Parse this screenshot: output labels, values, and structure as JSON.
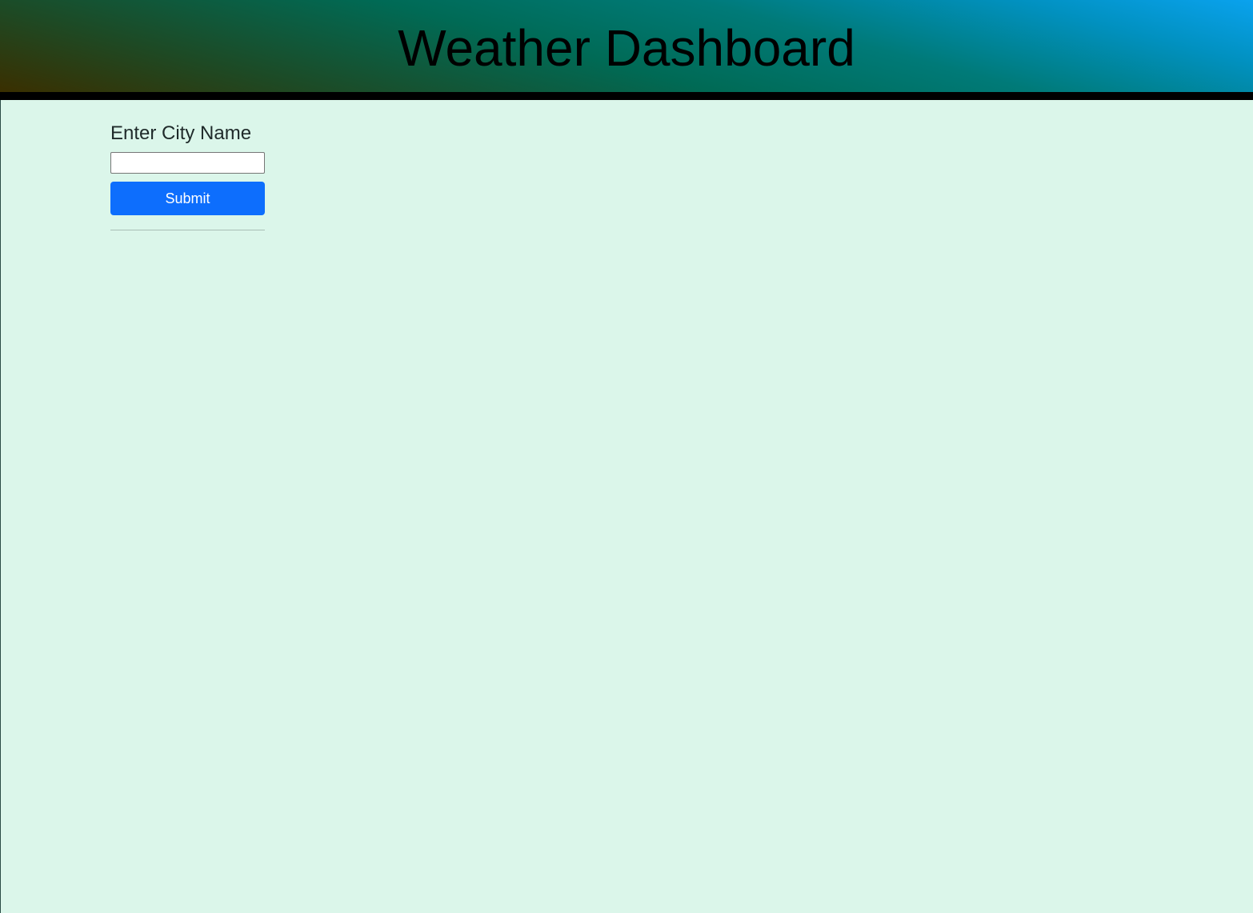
{
  "header": {
    "title": "Weather Dashboard"
  },
  "search": {
    "label": "Enter City Name",
    "value": "",
    "placeholder": "",
    "submit_label": "Submit"
  },
  "colors": {
    "background": "#dbf6ea",
    "submit_button": "#0d6efd",
    "header_rule": "#000000"
  }
}
